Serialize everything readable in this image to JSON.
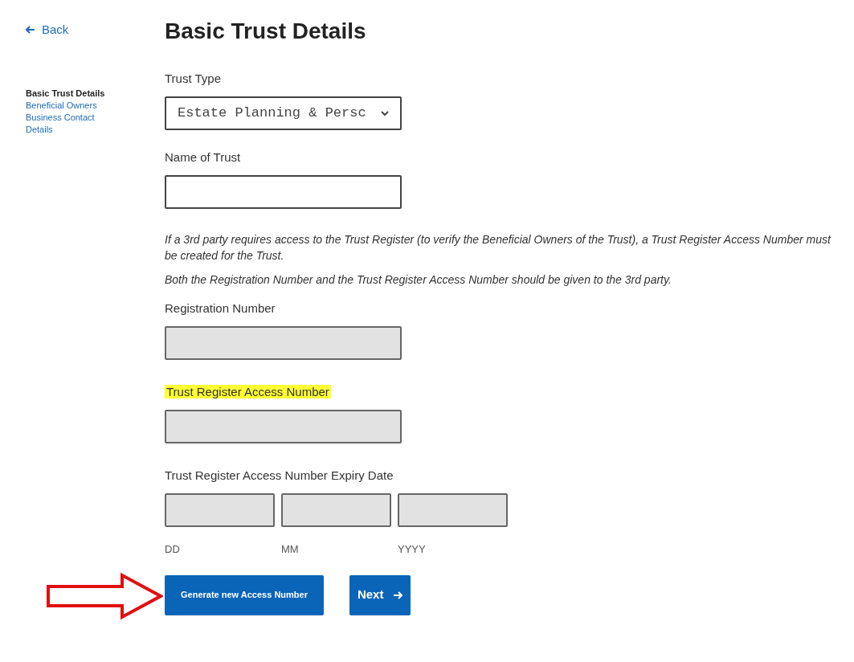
{
  "back_link": {
    "label": "Back"
  },
  "sidebar": {
    "items": [
      {
        "label": "Basic Trust Details",
        "selected": true
      },
      {
        "label": "Beneficial Owners",
        "selected": false
      },
      {
        "label": "Business Contact Details",
        "selected": false
      }
    ]
  },
  "title": "Basic Trust Details",
  "sections": [
    {
      "kind": "select",
      "label": "Trust Type",
      "highlighted": false,
      "value": "Estate Planning & Persc",
      "disabled": false
    },
    {
      "kind": "text",
      "label": "Name of Trust",
      "highlighted": false,
      "disabled": false
    },
    {
      "kind": "note",
      "paragraphs": [
        "If a 3rd party requires access to the Trust Register (to verify the Beneficial Owners of the Trust), a Trust Register Access Number must be created for the Trust.",
        "Both the Registration Number and the Trust Register Access Number should be given to the 3rd party."
      ]
    },
    {
      "kind": "text",
      "label": "Registration Number",
      "highlighted": false,
      "disabled": true
    },
    {
      "kind": "text",
      "label": "Trust Register Access Number",
      "highlighted": true,
      "disabled": true
    },
    {
      "kind": "date",
      "label": "Trust Register Access Number Expiry Date",
      "highlighted": false,
      "disabled": true,
      "parts": [
        "DD",
        "MM",
        "YYYY"
      ]
    }
  ],
  "buttons": [
    {
      "label": "Generate new Access Number",
      "arrow": false,
      "annotated": true
    },
    {
      "label": "Next",
      "arrow": true,
      "annotated": false
    }
  ]
}
